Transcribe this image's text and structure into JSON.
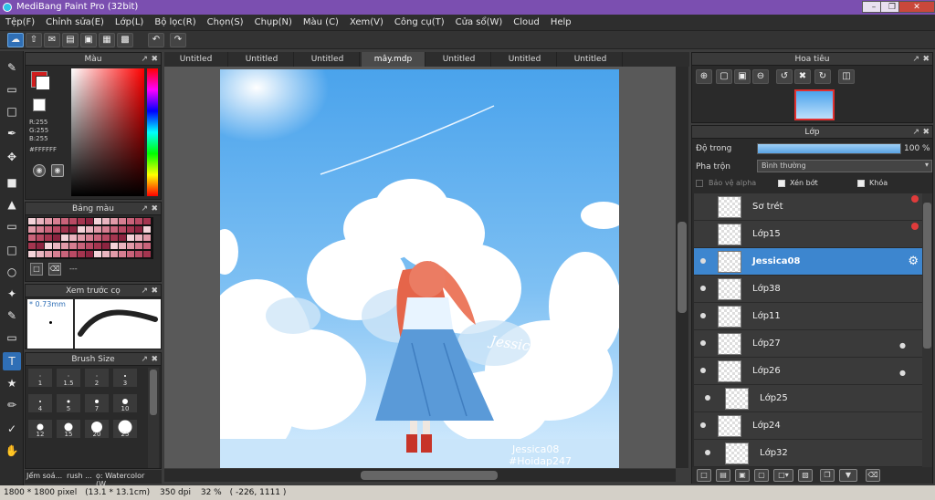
{
  "window": {
    "title": "MediBang Paint Pro (32bit)"
  },
  "menu": [
    "Tệp(F)",
    "Chỉnh sửa(E)",
    "Lớp(L)",
    "Bộ lọc(R)",
    "Chọn(S)",
    "Chụp(N)",
    "Màu (C)",
    "Xem(V)",
    "Công cụ(T)",
    "Cửa sổ(W)",
    "Cloud",
    "Help"
  ],
  "color_panel": {
    "title": "Màu",
    "r": "R:255",
    "g": "G:255",
    "b": "B:255",
    "hex": "#FFFFFF",
    "primary": "#ffffff",
    "secondary": "#d11d1d"
  },
  "palette_panel": {
    "title": "Bảng màu",
    "dash": "---"
  },
  "brush_preview": {
    "title": "Xem trước cọ",
    "size": "* 0.73mm"
  },
  "brush_size": {
    "title": "Brush Size",
    "sizes": [
      "1",
      "1.5",
      "2",
      "3",
      "4",
      "5",
      "7",
      "10",
      "12",
      "15",
      "20",
      "25"
    ]
  },
  "bottom_tabs": [
    "Jểm soá...",
    "rush ...",
    "ọ: Watercolor (W..."
  ],
  "tabs": [
    "Untitled",
    "Untitled",
    "Untitled",
    "mây.mdp",
    "Untitled",
    "Untitled",
    "Untitled"
  ],
  "navigator": {
    "title": "Hoa tiêu"
  },
  "layers": {
    "title": "Lớp",
    "opacity_label": "Độ trong",
    "opacity_value": "100 %",
    "opacity": 1.0,
    "blend_label": "Pha trộn",
    "blend_value": "Bình thường",
    "protect_alpha": "Bảo vệ alpha",
    "clip": "Xén bớt",
    "lock": "Khóa",
    "items": [
      "Sơ trét",
      "Lớp15",
      "Jessica08",
      "Lớp38",
      "Lớp11",
      "Lớp27",
      "Lớp26",
      "Lớp25",
      "Lớp24",
      "Lớp32"
    ]
  },
  "artwork": {
    "signature": "Jessica",
    "watermark_line1": "Jessica08",
    "watermark_line2": "#Hoidap247"
  },
  "status": {
    "size": "1800 * 1800 pixel",
    "cm": "(13.1 * 13.1cm)",
    "dpi": "350 dpi",
    "zoom": "32 %",
    "coords": "( -226, 1111 )"
  }
}
